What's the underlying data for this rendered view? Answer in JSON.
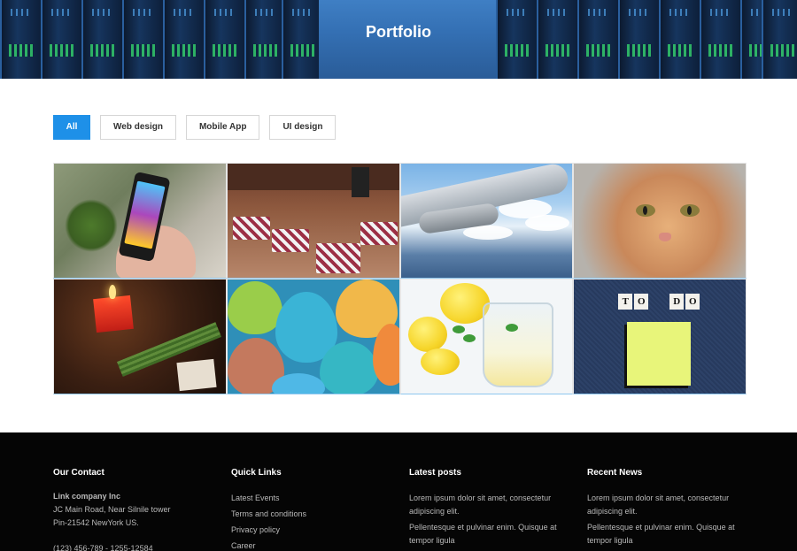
{
  "banner": {
    "title": "Portfolio"
  },
  "filters": {
    "items": [
      {
        "label": "All",
        "active": true
      },
      {
        "label": "Web design",
        "active": false
      },
      {
        "label": "Mobile App",
        "active": false
      },
      {
        "label": "UI design",
        "active": false
      }
    ]
  },
  "gallery": {
    "items": [
      {
        "subject": "phone"
      },
      {
        "subject": "cafe"
      },
      {
        "subject": "airplane-wing"
      },
      {
        "subject": "cat"
      },
      {
        "subject": "candle"
      },
      {
        "subject": "easter-eggs"
      },
      {
        "subject": "lemon-water"
      },
      {
        "subject": "todo-note",
        "letters": [
          "T",
          "O",
          "D",
          "O"
        ]
      }
    ]
  },
  "footer": {
    "contact": {
      "heading": "Our Contact",
      "company": "Link company Inc",
      "address1": "JC Main Road, Near Silnile tower",
      "address2": "Pin-21542 NewYork US.",
      "phone": "(123) 456-789 - 1255-12584"
    },
    "quick_links": {
      "heading": "Quick Links",
      "items": [
        "Latest Events",
        "Terms and conditions",
        "Privacy policy",
        "Career"
      ]
    },
    "latest_posts": {
      "heading": "Latest posts",
      "posts": [
        "Lorem ipsum dolor sit amet, consectetur adipiscing elit.",
        "Pellentesque et pulvinar enim. Quisque at tempor ligula"
      ]
    },
    "recent_news": {
      "heading": "Recent News",
      "posts": [
        "Lorem ipsum dolor sit amet, consectetur adipiscing elit.",
        "Pellentesque et pulvinar enim. Quisque at tempor ligula"
      ]
    }
  },
  "colors": {
    "accent": "#1e90e8",
    "footer_bg": "#050505"
  }
}
